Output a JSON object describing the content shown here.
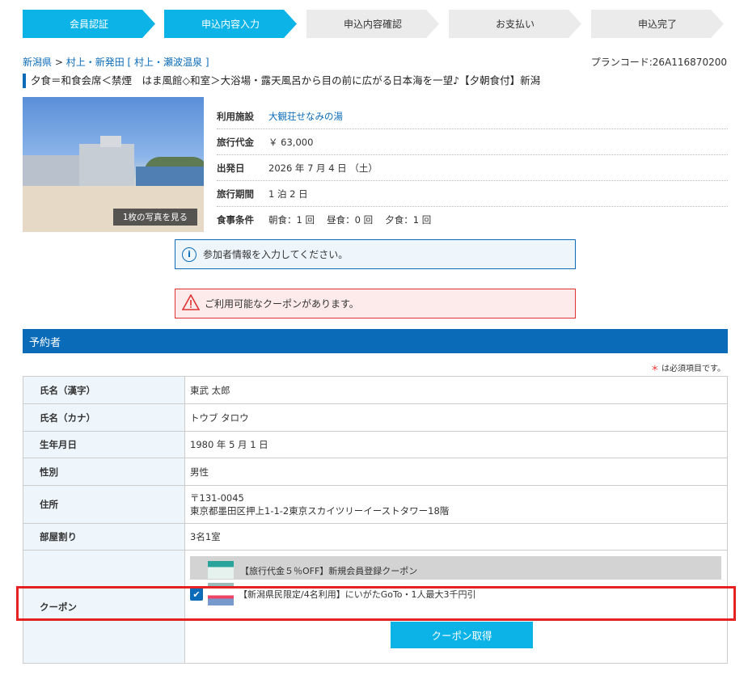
{
  "steps": [
    {
      "label": "会員認証",
      "state": "active"
    },
    {
      "label": "申込内容入力",
      "state": "active"
    },
    {
      "label": "申込内容確認",
      "state": "inactive"
    },
    {
      "label": "お支払い",
      "state": "inactive"
    },
    {
      "label": "申込完了",
      "state": "inactive"
    }
  ],
  "breadcrumb": {
    "pref": "新潟県",
    "sep1": " > ",
    "area": "村上・新発田",
    "bracket_open": " [ ",
    "sub": "村上・瀬波温泉",
    "bracket_close": " ]"
  },
  "plan_code": "プランコード:26A116870200",
  "plan_title": "夕食＝和食会席＜禁煙　はま風館◇和室＞大浴場・露天風呂から目の前に広がる日本海を一望♪【夕朝食付】新潟",
  "photo": {
    "button": "1枚の写真を見る"
  },
  "info": {
    "facility_label": "利用施設",
    "facility": "大観荘せなみの湯",
    "price_label": "旅行代金",
    "price": "￥ 63,000",
    "depart_label": "出発日",
    "depart": "2026 年 7 月 4 日 （土）",
    "period_label": "旅行期間",
    "period": "1 泊 2 日",
    "meal_label": "食事条件",
    "meal": "朝食：1 回　 昼食：0 回　 夕食：1 回"
  },
  "notices": {
    "info": "参加者情報を入力してください。",
    "warn": "ご利用可能なクーポンがあります。"
  },
  "section_title": "予約者",
  "required_note": "は必須項目です。",
  "required_mark": "＊",
  "form": {
    "name_kanji_label": "氏名（漢字）",
    "name_kanji": "東武 太郎",
    "name_kana_label": "氏名（カナ）",
    "name_kana": "トウブ タロウ",
    "birth_label": "生年月日",
    "birth": "1980 年 5 月 1 日",
    "gender_label": "性別",
    "gender": "男性",
    "address_label": "住所",
    "postal": "〒131-0045",
    "address": "東京都墨田区押上1-1-2東京スカイツリーイーストタワー18階",
    "rooms_label": "部屋割り",
    "rooms": "3名1室",
    "coupon_label": "クーポン",
    "coupon1": "【旅行代金５％OFF】新規会員登録クーポン",
    "coupon2": "【新潟県民限定/4名利用】にいがたGoTo・1人最大3千円引",
    "coupon2_checked": true,
    "get_coupon": "クーポン取得"
  },
  "colors": {
    "accent": "#0bb3e6",
    "brand": "#0a6bb8",
    "highlight": "#e52222"
  }
}
